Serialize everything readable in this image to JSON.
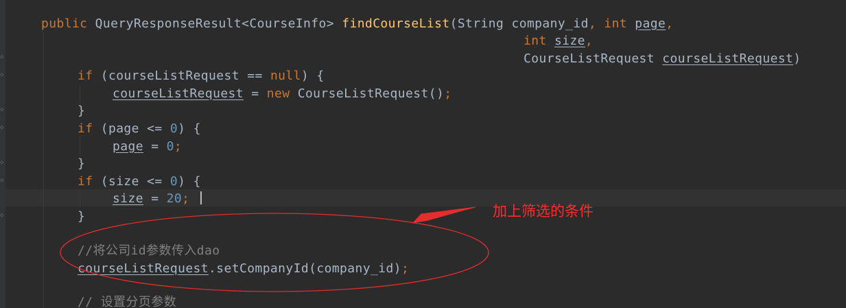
{
  "code": {
    "line1": {
      "kw_public": "public",
      "type": " QueryResponseResult<CourseInfo> ",
      "method": "findCourseList",
      "open": "(String company_id",
      "comma1": ", ",
      "kw_int": "int",
      "sp": " ",
      "page": "page",
      "comma2": ","
    },
    "line2": {
      "kw_int": "int",
      "sp": " ",
      "size": "size",
      "comma": ","
    },
    "line3": {
      "prefix": "CourseListRequest ",
      "var": "courseListRequest",
      "close": ")"
    },
    "line4": {
      "kw_if": "if",
      "mid": " (courseListRequest == ",
      "kw_null": "null",
      "end": ") {"
    },
    "line5": {
      "var": "courseListRequest",
      "eq": " = ",
      "kw_new": "new",
      "rest": " CourseListRequest()",
      "semi": ";"
    },
    "line6": {
      "text": "}"
    },
    "line7": {
      "kw_if": "if",
      "mid": " (page <= ",
      "num": "0",
      "end": ") {"
    },
    "line8": {
      "var": "page",
      "eq": " = ",
      "num": "0",
      "semi": ";"
    },
    "line9": {
      "text": "}"
    },
    "line10": {
      "kw_if": "if",
      "mid": " (size <= ",
      "num": "0",
      "end": ") {"
    },
    "line11": {
      "var": "size",
      "eq": " = ",
      "num": "20",
      "semi": ";"
    },
    "line12": {
      "text": "}"
    },
    "line13": {
      "comment": "//将公司id参数传入dao"
    },
    "line14": {
      "var": "courseListRequest",
      "call": ".setCompanyId(company_id)",
      "semi": ";"
    },
    "line15": {
      "comment": "// 设置分页参数"
    }
  },
  "annotation": {
    "text": "加上筛选的条件",
    "color": "#ff2d2d"
  },
  "colors": {
    "background": "#2b2b2b",
    "keyword": "#cc7832",
    "method": "#ffc66d",
    "number": "#6897bb",
    "comment": "#808080",
    "text": "#a9b7c6"
  }
}
